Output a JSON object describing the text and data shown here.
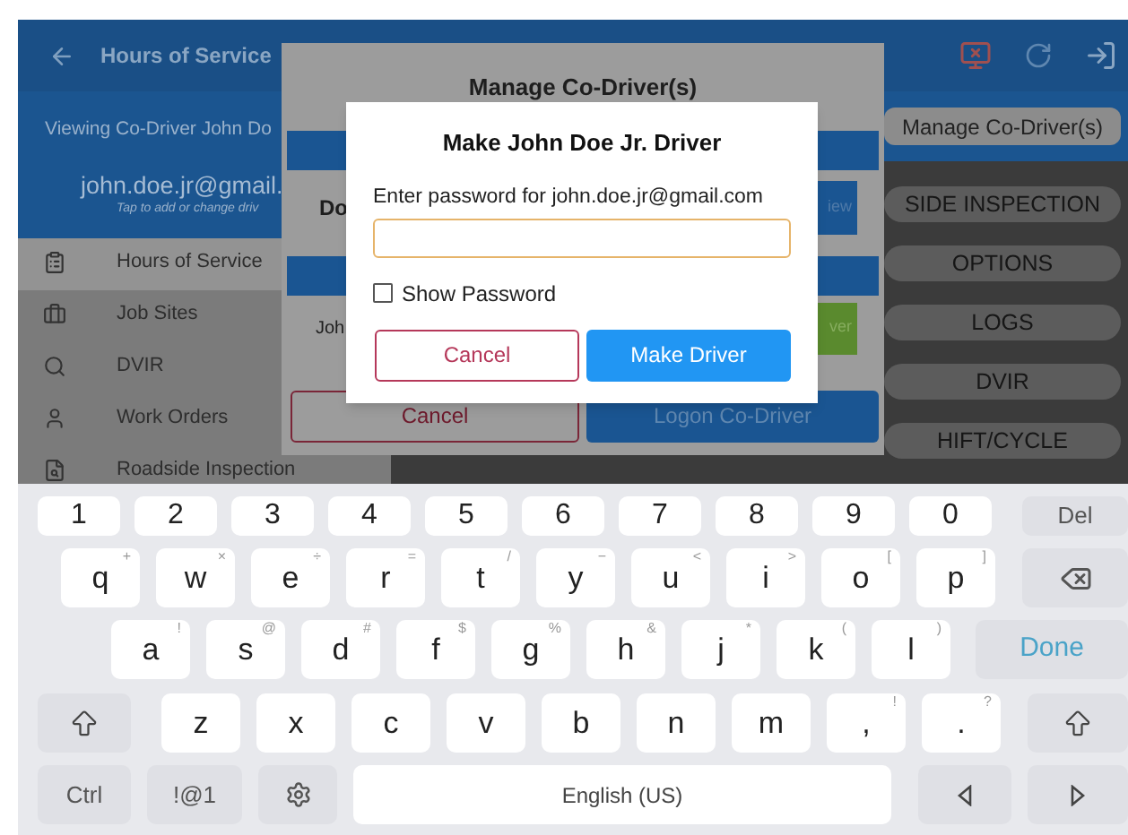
{
  "header": {
    "title": "Hours of Service"
  },
  "sidebar": {
    "viewing": "Viewing Co-Driver John Do",
    "email": "john.doe.jr@gmail.",
    "hint": "Tap to add or change driv",
    "items": [
      {
        "label": "Hours of Service",
        "kind": "clipboard",
        "selected": true
      },
      {
        "label": "Job Sites",
        "kind": "briefcase",
        "selected": false
      },
      {
        "label": "DVIR",
        "kind": "search",
        "selected": false
      },
      {
        "label": "Work Orders",
        "kind": "person",
        "selected": false
      },
      {
        "label": "Roadside Inspection",
        "kind": "doc",
        "selected": false
      }
    ]
  },
  "main": {
    "manage_button": "Manage Co-Driver(s)",
    "buttons": [
      "SIDE INSPECTION",
      "OPTIONS",
      "LOGS",
      "DVIR",
      "HIFT/CYCLE"
    ]
  },
  "manage_dialog": {
    "title": "Manage Co-Driver(s)",
    "driver_label": "Do",
    "driver_button": "iew",
    "codriver_label": "Joh",
    "codriver_button": "ver",
    "cancel": "Cancel",
    "logon": "Logon Co-Driver"
  },
  "dialog": {
    "title": "Make John Doe Jr. Driver",
    "prompt": "Enter password for john.doe.jr@gmail.com",
    "show_password": {
      "label": "Show Password",
      "checked": false
    },
    "cancel": "Cancel",
    "confirm": "Make Driver"
  },
  "keyboard": {
    "rows": [
      {
        "keys": [
          {
            "kind": "num",
            "label": "1"
          },
          {
            "kind": "num",
            "label": "2"
          },
          {
            "kind": "num",
            "label": "3"
          },
          {
            "kind": "num",
            "label": "4"
          },
          {
            "kind": "num",
            "label": "5"
          },
          {
            "kind": "num",
            "label": "6"
          },
          {
            "kind": "num",
            "label": "7"
          },
          {
            "kind": "num",
            "label": "8"
          },
          {
            "kind": "num",
            "label": "9"
          },
          {
            "kind": "num",
            "label": "0"
          },
          {
            "kind": "fn",
            "label": "Del"
          }
        ]
      },
      {
        "keys": [
          {
            "kind": "char",
            "label": "q",
            "hint": "+"
          },
          {
            "kind": "char",
            "label": "w",
            "hint": "×"
          },
          {
            "kind": "char",
            "label": "e",
            "hint": "÷"
          },
          {
            "kind": "char",
            "label": "r",
            "hint": "="
          },
          {
            "kind": "char",
            "label": "t",
            "hint": "/"
          },
          {
            "kind": "char",
            "label": "y",
            "hint": "−"
          },
          {
            "kind": "char",
            "label": "u",
            "hint": "<"
          },
          {
            "kind": "char",
            "label": "i",
            "hint": ">"
          },
          {
            "kind": "char",
            "label": "o",
            "hint": "["
          },
          {
            "kind": "char",
            "label": "p",
            "hint": "]"
          },
          {
            "kind": "backspace"
          }
        ]
      },
      {
        "keys": [
          {
            "kind": "char",
            "label": "a",
            "hint": "!"
          },
          {
            "kind": "char",
            "label": "s",
            "hint": "@"
          },
          {
            "kind": "char",
            "label": "d",
            "hint": "#"
          },
          {
            "kind": "char",
            "label": "f",
            "hint": "$"
          },
          {
            "kind": "char",
            "label": "g",
            "hint": "%"
          },
          {
            "kind": "char",
            "label": "h",
            "hint": "&"
          },
          {
            "kind": "char",
            "label": "j",
            "hint": "*"
          },
          {
            "kind": "char",
            "label": "k",
            "hint": "("
          },
          {
            "kind": "char",
            "label": "l",
            "hint": ")"
          },
          {
            "kind": "done",
            "label": "Done"
          }
        ]
      },
      {
        "keys": [
          {
            "kind": "shift"
          },
          {
            "kind": "char",
            "label": "z"
          },
          {
            "kind": "char",
            "label": "x"
          },
          {
            "kind": "char",
            "label": "c"
          },
          {
            "kind": "char",
            "label": "v"
          },
          {
            "kind": "char",
            "label": "b"
          },
          {
            "kind": "char",
            "label": "n"
          },
          {
            "kind": "char",
            "label": "m"
          },
          {
            "kind": "char",
            "label": ",",
            "hint": "!"
          },
          {
            "kind": "char",
            "label": ".",
            "hint": "?"
          },
          {
            "kind": "shift"
          }
        ]
      },
      {
        "keys": [
          {
            "kind": "fn",
            "label": "Ctrl"
          },
          {
            "kind": "fn",
            "label": "!@1"
          },
          {
            "kind": "settings"
          },
          {
            "kind": "space",
            "label": "English (US)"
          },
          {
            "kind": "left"
          },
          {
            "kind": "right"
          }
        ]
      }
    ]
  }
}
